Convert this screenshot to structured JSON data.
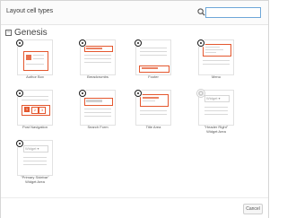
{
  "dialog": {
    "title": "Layout cell types",
    "search": {
      "placeholder": "",
      "value": ""
    },
    "group": {
      "label": "Genesis",
      "toggle": "−"
    },
    "footer": {
      "cancel_label": "Cancel"
    }
  },
  "tiles": [
    {
      "label": "Author Box",
      "has_badge": true
    },
    {
      "label": "Breadcrumbs",
      "has_badge": true
    },
    {
      "label": "Footer",
      "has_badge": true
    },
    {
      "label": "Menu",
      "has_badge": true
    },
    {
      "label": "Post Navigation",
      "has_badge": true
    },
    {
      "label": "Search Form",
      "has_badge": true
    },
    {
      "label": "Title Area",
      "has_badge": true
    },
    {
      "label": "\"Header Right\"\nWidget Area",
      "has_badge": false
    },
    {
      "label": "\"Primary Sidebar\"\nWidget Area",
      "has_badge": true
    }
  ],
  "thumb_texts": {
    "post_navigation_pages": [
      "1",
      "2",
      "3"
    ],
    "widget_label_header": "Widget ▾",
    "widget_label_primary": "Widget ▾"
  },
  "colors": {
    "accent_orange": "#e4572e",
    "badge_dark": "#1a1a1a",
    "search_focus": "#6ea7d8"
  }
}
